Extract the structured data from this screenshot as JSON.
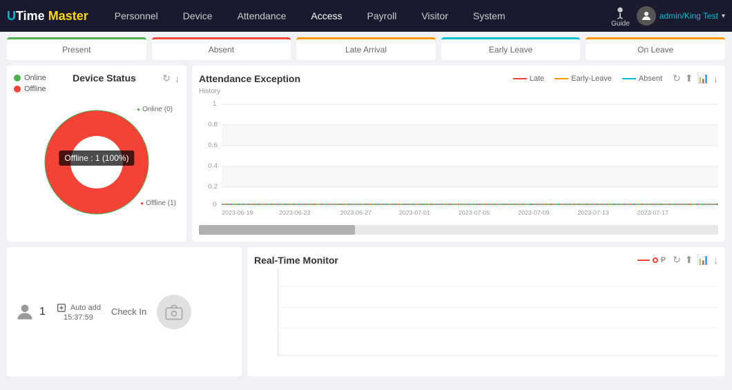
{
  "header": {
    "logo": {
      "u": "U",
      "time": "Time",
      "master": "Master"
    },
    "nav": [
      {
        "label": "Personnel",
        "active": false
      },
      {
        "label": "Device",
        "active": false
      },
      {
        "label": "Attendance",
        "active": false
      },
      {
        "label": "Access",
        "active": true
      },
      {
        "label": "Payroll",
        "active": false
      },
      {
        "label": "Visitor",
        "active": false
      },
      {
        "label": "System",
        "active": false
      }
    ],
    "guide_label": "Guide",
    "user_name": "admin/King Test",
    "chevron": "▾"
  },
  "stats": [
    {
      "label": "Present",
      "type": "present"
    },
    {
      "label": "Absent",
      "type": "absent"
    },
    {
      "label": "Late Arrival",
      "type": "late"
    },
    {
      "label": "Early Leave",
      "type": "early-leave"
    },
    {
      "label": "On Leave",
      "type": "on-leave"
    }
  ],
  "device_status": {
    "title": "Device Status",
    "legend": [
      {
        "label": "Online",
        "type": "online"
      },
      {
        "label": "Offline",
        "type": "offline"
      }
    ],
    "online_label": "Online (0)",
    "offline_label": "Offline (1)",
    "tooltip": "Offline : 1 (100%)",
    "refresh_icon": "↻",
    "download_icon": "↓"
  },
  "attendance_exception": {
    "title": "Attendance Exception",
    "history_label": "History",
    "legend": [
      {
        "label": "Late",
        "color": "#f44336"
      },
      {
        "label": "Early-Leave",
        "color": "#ff9800"
      },
      {
        "label": "Absent",
        "color": "#00bcd4"
      }
    ],
    "y_axis": [
      "1",
      "0.8",
      "0.6",
      "0.4",
      "0.2",
      "0"
    ],
    "x_axis": [
      "2023-06-19",
      "2023-06-23",
      "2023-06-27",
      "2023-07-01",
      "2023-07-05",
      "2023-07-09",
      "2023-07-13",
      "2023-07-17"
    ],
    "refresh_icon": "↻",
    "upload_icon": "⬆",
    "chart_icon": "📊",
    "download_icon": "↓"
  },
  "checkin": {
    "user_count": "1",
    "auto_add_label": "Auto add",
    "auto_add_time": "15:37:59",
    "checkin_label": "Check In",
    "camera_icon": "📷"
  },
  "realtime_monitor": {
    "title": "Real-Time Monitor",
    "legend_p": "P",
    "refresh_icon": "↻",
    "upload_icon": "⬆",
    "chart_icon": "📊",
    "download_icon": "↓"
  },
  "colors": {
    "online": "#4caf50",
    "offline": "#f44336",
    "late": "#f44336",
    "early_leave": "#ff9800",
    "absent": "#00bcd4",
    "p_line": "#f44336"
  }
}
